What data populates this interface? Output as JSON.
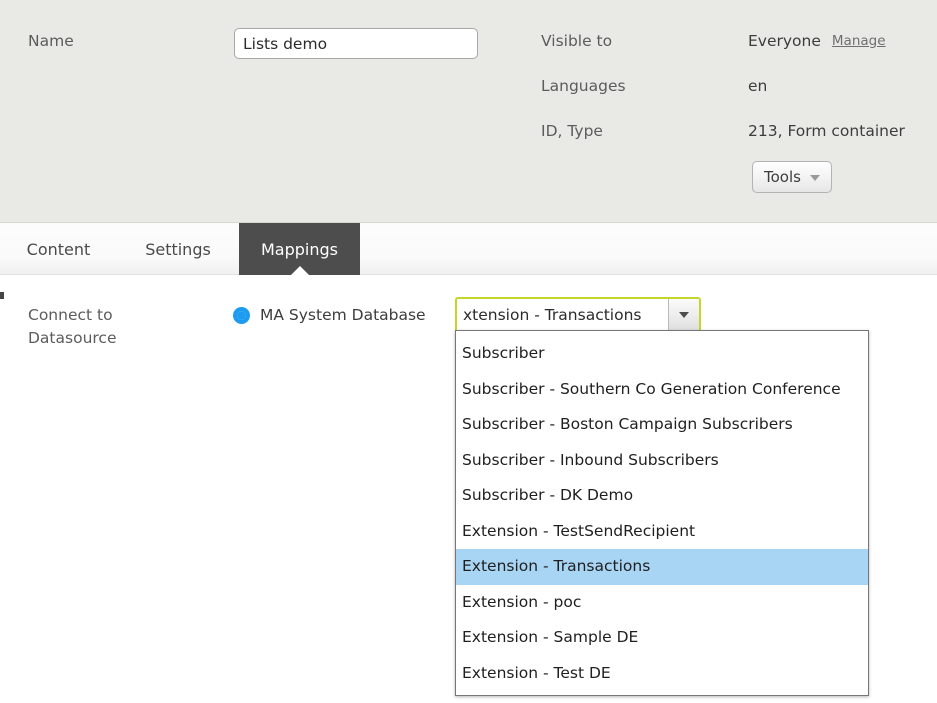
{
  "header": {
    "name_label": "Name",
    "name_value": "Lists demo",
    "visible_label": "Visible to",
    "visible_value": "Everyone",
    "manage_link": "Manage",
    "languages_label": "Languages",
    "languages_value": "en",
    "id_type_label": "ID, Type",
    "id_type_value": "213, Form container",
    "tools_button": "Tools"
  },
  "tabs": [
    {
      "label": "Content",
      "active": false
    },
    {
      "label": "Settings",
      "active": false
    },
    {
      "label": "Mappings",
      "active": true
    }
  ],
  "content": {
    "datasource_label_line1": "Connect to",
    "datasource_label_line2": "Datasource",
    "radio_label": "MA System Database",
    "combo_value": "xtension - Transactions",
    "combo_full_value": "Extension - Transactions"
  },
  "dropdown": {
    "selected_index": 6,
    "items": [
      "Subscriber",
      "Subscriber - Southern Co Generation Conference",
      "Subscriber - Boston Campaign Subscribers",
      "Subscriber - Inbound Subscribers",
      "Subscriber - DK Demo",
      "Extension - TestSendRecipient",
      "Extension - Transactions",
      "Extension - poc",
      "Extension - Sample DE",
      "Extension - Test DE"
    ]
  },
  "colors": {
    "header_bg": "#e9eae5",
    "active_tab_bg": "#4d4d4d",
    "focus_border": "#c4d62a",
    "highlight": "#a9d5f5",
    "radio_accent": "#1d9bf0"
  }
}
